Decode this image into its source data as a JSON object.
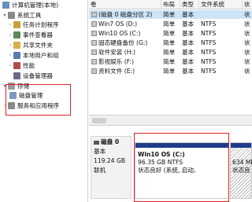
{
  "tree": {
    "items": [
      {
        "label": "计算机管理(本地)",
        "expander": "",
        "icon": "computer-icon",
        "color": "#6b8fbf"
      },
      {
        "label": "系统工具",
        "expander": "▾",
        "icon": "tools-icon",
        "color": "#8a8a8a"
      },
      {
        "label": "任务计划程序",
        "expander": "›",
        "icon": "clock-icon",
        "color": "#c9a13a"
      },
      {
        "label": "事件查看器",
        "expander": "›",
        "icon": "event-viewer-icon",
        "color": "#5a8a5a"
      },
      {
        "label": "共享文件夹",
        "expander": "›",
        "icon": "shared-folder-icon",
        "color": "#d8b04a"
      },
      {
        "label": "本地用户和组",
        "expander": "›",
        "icon": "users-icon",
        "color": "#5a7ab0"
      },
      {
        "label": "性能",
        "expander": "›",
        "icon": "performance-icon",
        "color": "#b04a4a"
      },
      {
        "label": "设备管理器",
        "expander": "",
        "icon": "device-manager-icon",
        "color": "#6a6a8a"
      },
      {
        "label": "存储",
        "expander": "▾",
        "icon": "storage-icon",
        "color": "#9a9a9a"
      },
      {
        "label": "磁盘管理",
        "expander": "",
        "icon": "disk-management-icon",
        "color": "#7a9ac0"
      },
      {
        "label": "服务和应用程序",
        "expander": "›",
        "icon": "services-icon",
        "color": "#8a8a8a"
      }
    ]
  },
  "table": {
    "headers": [
      "卷",
      "布局",
      "类型",
      "文件系统",
      "状"
    ],
    "rows": [
      [
        "(磁盘 0 磁盘分区 2)",
        "简单",
        "基本",
        "",
        "状"
      ],
      [
        "Win7 OS (D:)",
        "简单",
        "基本",
        "NTFS",
        "状"
      ],
      [
        "Win10 OS (C:)",
        "简单",
        "基本",
        "NTFS",
        "状"
      ],
      [
        "固态硬盘备份 (G:)",
        "简单",
        "基本",
        "NTFS",
        "状"
      ],
      [
        "软件安装 (H:)",
        "简单",
        "基本",
        "NTFS",
        "状"
      ],
      [
        "影视娱乐 (F:)",
        "简单",
        "基本",
        "NTFS",
        "状"
      ],
      [
        "资料文件 (E:)",
        "简单",
        "基本",
        "NTFS",
        "状"
      ]
    ]
  },
  "disk": {
    "name": "磁盘 0",
    "type": "基本",
    "size": "119.24 GB",
    "status": "联机"
  },
  "partitions": [
    {
      "name": "Win10 OS (C:)",
      "size": "96.35 GB NTFS",
      "status": "状态良好 (系统, 启动,"
    },
    {
      "name": "",
      "size": "634 MB",
      "status": "状态良"
    }
  ]
}
